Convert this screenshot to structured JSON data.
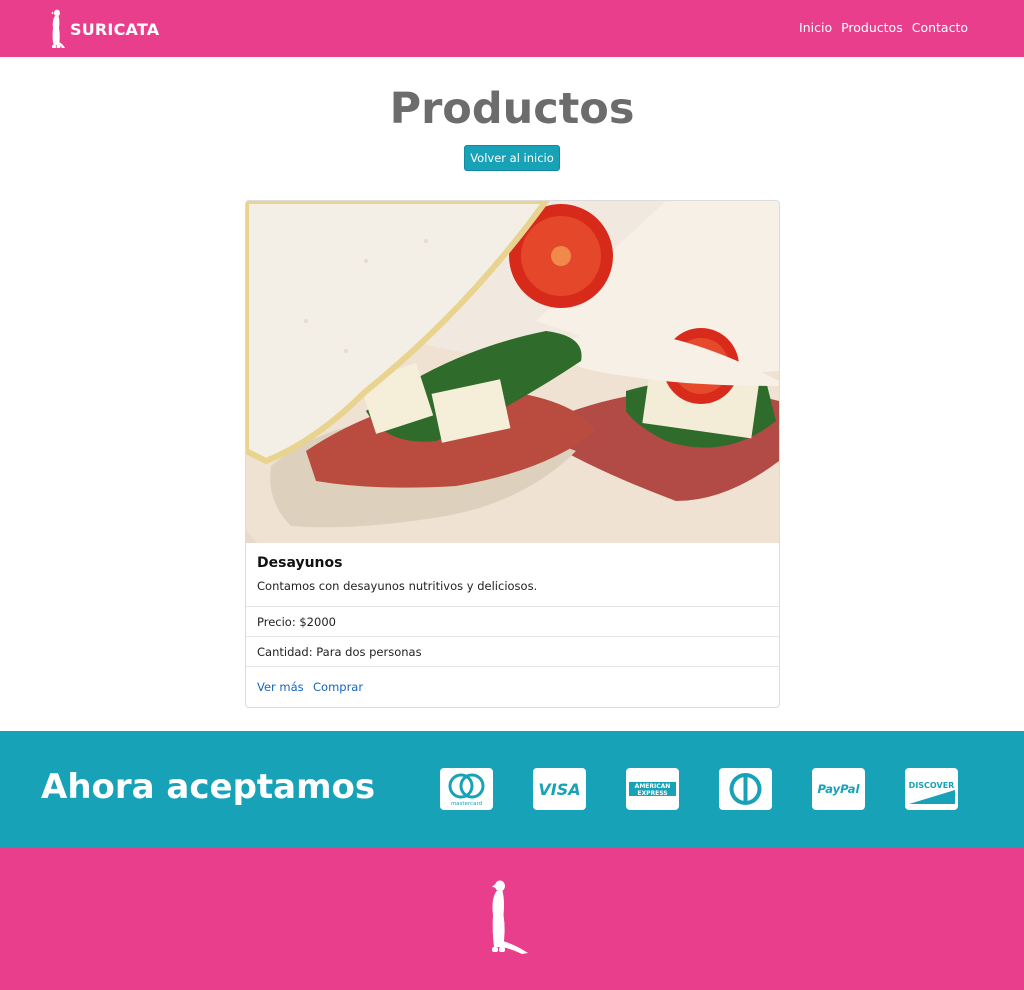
{
  "navbar": {
    "brand": "SURICATA",
    "links": [
      "Inicio",
      "Productos",
      "Contacto"
    ]
  },
  "header": {
    "title": "Productos",
    "back_button": "Volver al inicio"
  },
  "product": {
    "title": "Desayunos",
    "description": "Contamos con desayunos nutritivos y deliciosos.",
    "price": "Precio: $2000",
    "quantity": "Cantidad: Para dos personas",
    "links": [
      "Ver más",
      "Comprar"
    ]
  },
  "payments": {
    "title": "Ahora aceptamos",
    "methods": [
      "mastercard",
      "VISA",
      "AMERICAN EXPRESS",
      "Diners Club",
      "PayPal",
      "DISCOVER"
    ]
  },
  "colors": {
    "brand_pink": "#e83e8c",
    "accent_teal": "#17a2b8",
    "link_blue": "#1565c0"
  }
}
